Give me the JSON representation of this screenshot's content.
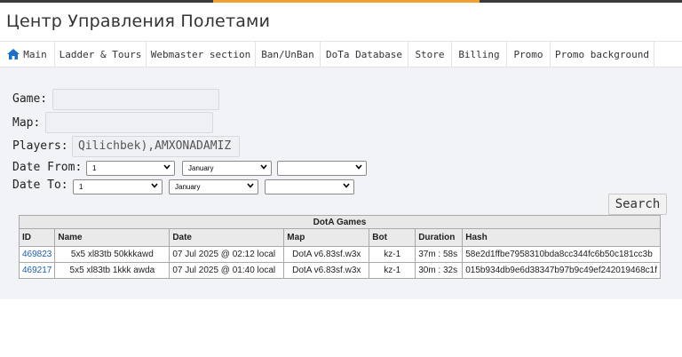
{
  "page": {
    "title": "Центр Управления Полетами"
  },
  "colors": {
    "link": "#1a5fb4",
    "nav_icon": "#1a6fc9",
    "panel_bg": "#f1f3f6"
  },
  "nav": {
    "items": [
      {
        "label": "Main",
        "icon": "home-icon"
      },
      {
        "label": "Ladder & Tours"
      },
      {
        "label": "Webmaster section"
      },
      {
        "label": "Ban/UnBan"
      },
      {
        "label": "DoTa Database"
      },
      {
        "label": "Store"
      },
      {
        "label": "Billing"
      },
      {
        "label": "Promo"
      },
      {
        "label": "Promo background"
      }
    ]
  },
  "form": {
    "game_label": "Game:",
    "game_value": "",
    "map_label": "Map:",
    "map_value": "",
    "players_label": "Players:",
    "players_value": "Qilichbek),AMXONADAMIZ",
    "date_from_label": "Date From:",
    "date_from": {
      "day": "1",
      "month": "January",
      "year": ""
    },
    "date_to_label": "Date To:",
    "date_to": {
      "day": "1",
      "month": "January",
      "year": ""
    },
    "search_label": "Search"
  },
  "table": {
    "caption": "DotA Games",
    "columns": [
      "ID",
      "Name",
      "Date",
      "Map",
      "Bot",
      "Duration",
      "Hash"
    ],
    "rows": [
      {
        "id": "469823",
        "name": "5x5 xl83tb 50kkkawd",
        "date": "07 Jul 2025 @ 02:12 local",
        "map": "DotA v6.83sf.w3x",
        "bot": "kz-1",
        "duration": "37m : 58s",
        "hash": "58e2d1ffbe7958310bda8cc344fc6b50c181cc3b"
      },
      {
        "id": "469217",
        "name": "5x5 xl83tb 1kkk awda",
        "date": "07 Jul 2025 @ 01:40 local",
        "map": "DotA v6.83sf.w3x",
        "bot": "kz-1",
        "duration": "30m : 32s",
        "hash": "015b934db9e6d38347b97b9c49ef242019468c1f"
      }
    ]
  }
}
